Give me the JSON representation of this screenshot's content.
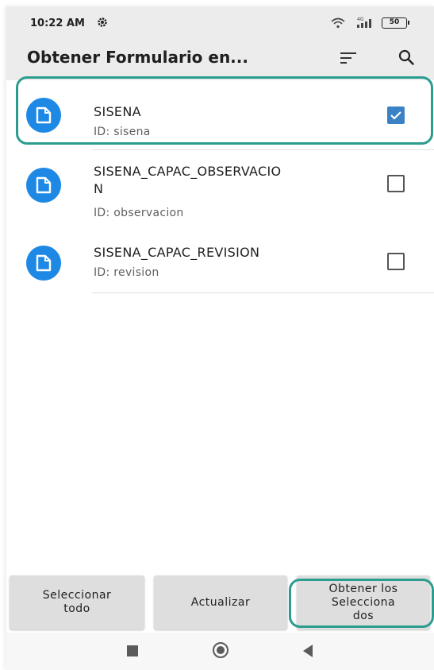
{
  "status_bar": {
    "time": "10:22 AM",
    "battery": "50",
    "network": "4G"
  },
  "app_bar": {
    "title": "Obtener Formulario en...",
    "sort_icon": "sort-icon",
    "search_icon": "search-icon"
  },
  "forms": [
    {
      "name": "SISENA",
      "id_text": "ID: sisena",
      "checked": true
    },
    {
      "name_line1": "SISENA_CAPAC_OBSERVACIO",
      "name_line2": "N",
      "id_text": "ID: observacion",
      "checked": false
    },
    {
      "name": "SISENA_CAPAC_REVISION",
      "id_text": "ID: revision",
      "checked": false
    }
  ],
  "buttons": {
    "select_all_line1": "Seleccionar",
    "select_all_line2": "todo",
    "refresh": "Actualizar",
    "get_selected_line1": "Obtener los",
    "get_selected_line2": "Selecciona",
    "get_selected_line3": "dos"
  },
  "colors": {
    "accent": "#1e88e5",
    "checkbox_checked": "#3b82c4",
    "highlight": "#2a9d8f"
  }
}
